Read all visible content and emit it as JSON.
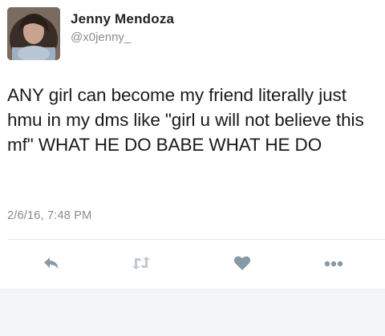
{
  "tweet": {
    "author_name": "Jenny Mendoza",
    "author_handle": "@x0jenny_",
    "text": "ANY girl can become my friend literally just hmu in my dms like \"girl u will not believe this mf\" WHAT HE DO BABE WHAT HE DO",
    "timestamp": "2/6/16, 7:48 PM"
  },
  "actions": [
    {
      "icon": "reply-icon"
    },
    {
      "icon": "retweet-icon"
    },
    {
      "icon": "heart-icon"
    },
    {
      "icon": "more-icon"
    }
  ],
  "colors": {
    "icon": "#8899a6",
    "icon_light": "#c0c8d0",
    "timestamp": "#8a8a8a",
    "handle": "#8c8c8c"
  }
}
